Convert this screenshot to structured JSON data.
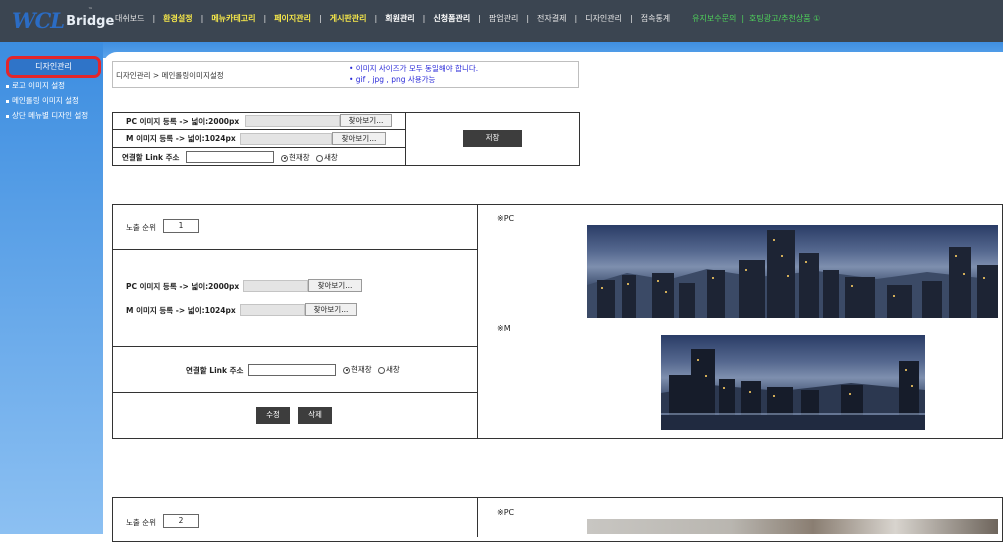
{
  "logo": {
    "word1": "WCL",
    "word2": "Bridge",
    "tm": "™"
  },
  "nav": {
    "items": [
      {
        "label": "대쉬보드",
        "style": "n"
      },
      {
        "label": "환경설정",
        "style": "y"
      },
      {
        "label": "메뉴카테고리",
        "style": "y"
      },
      {
        "label": "페이지관리",
        "style": "y"
      },
      {
        "label": "게시판관리",
        "style": "y"
      },
      {
        "label": "회원관리",
        "style": "w"
      },
      {
        "label": "신청폼관리",
        "style": "w"
      },
      {
        "label": "팝업관리",
        "style": "n"
      },
      {
        "label": "전자결제",
        "style": "n"
      },
      {
        "label": "디자인관리",
        "style": "n"
      },
      {
        "label": "접속통계",
        "style": "n"
      }
    ],
    "separator": "|",
    "extra": [
      "유지보수문의",
      "호팅광고/추천상품 ①"
    ]
  },
  "sidebar": {
    "header": "디자인관리",
    "items": [
      {
        "label": "로고 이미지 설정"
      },
      {
        "label": "메인롤링 이미지 설정"
      },
      {
        "label": "상단 메뉴별 디자인 설정"
      }
    ]
  },
  "breadcrumb": "디자인관리 > 메인롤링이미지설정",
  "notice": [
    "• 이미지 사이즈가 모두 동일해야 합니다.",
    "• gif , jpg , png 사용가능"
  ],
  "register": {
    "pc_label": "PC 이미지 등록 -> 넓이:2000px",
    "m_label": "M 이미지 등록 -> 넓이:1024px",
    "link_label": "연결할 Link 주소",
    "browse": "찾아보기...",
    "radio_current": "현재창",
    "radio_new": "새창",
    "save": "저장"
  },
  "items": [
    {
      "order_label": "노출 순위",
      "order": "1",
      "pc_label": "PC 이미지 등록 -> 넓이:2000px",
      "m_label": "M 이미지 등록 -> 넓이:1024px",
      "browse": "찾아보기...",
      "link_label": "연결할 Link 주소",
      "radio_current": "현재창",
      "radio_new": "새창",
      "edit": "수정",
      "delete": "삭제",
      "pc_mark": "※PC",
      "m_mark": "※M"
    },
    {
      "order_label": "노출 순위",
      "order": "2",
      "pc_mark": "※PC"
    }
  ],
  "colors": {
    "topbar": "#3b4551",
    "frame_blue": "#3f8ee0",
    "accent_red": "#e3262b",
    "nav_yellow": "#f4e64a",
    "nav_green": "#4fd35a",
    "notice_blue": "#2a2ad8"
  }
}
